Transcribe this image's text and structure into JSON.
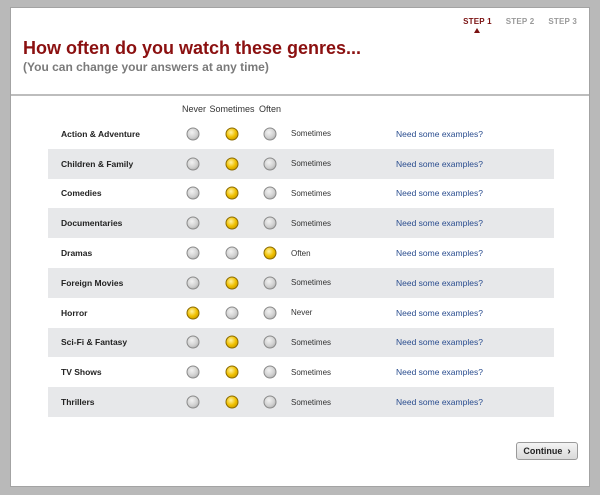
{
  "steps": [
    {
      "label": "STEP 1",
      "active": true
    },
    {
      "label": "STEP 2",
      "active": false
    },
    {
      "label": "STEP 3",
      "active": false
    }
  ],
  "header": {
    "title": "How often do you watch these genres...",
    "subtitle": "(You can change your answers at any time)"
  },
  "columns": {
    "never": "Never",
    "sometimes": "Sometimes",
    "often": "Often"
  },
  "genres": [
    {
      "name": "Action & Adventure",
      "selected": "sometimes",
      "answer": "Sometimes",
      "link": "Need some examples?"
    },
    {
      "name": "Children & Family",
      "selected": "sometimes",
      "answer": "Sometimes",
      "link": "Need some examples?"
    },
    {
      "name": "Comedies",
      "selected": "sometimes",
      "answer": "Sometimes",
      "link": "Need some examples?"
    },
    {
      "name": "Documentaries",
      "selected": "sometimes",
      "answer": "Sometimes",
      "link": "Need some examples?"
    },
    {
      "name": "Dramas",
      "selected": "often",
      "answer": "Often",
      "link": "Need some examples?"
    },
    {
      "name": "Foreign Movies",
      "selected": "sometimes",
      "answer": "Sometimes",
      "link": "Need some examples?"
    },
    {
      "name": "Horror",
      "selected": "never",
      "answer": "Never",
      "link": "Need some examples?"
    },
    {
      "name": "Sci-Fi & Fantasy",
      "selected": "sometimes",
      "answer": "Sometimes",
      "link": "Need some examples?"
    },
    {
      "name": "TV Shows",
      "selected": "sometimes",
      "answer": "Sometimes",
      "link": "Need some examples?"
    },
    {
      "name": "Thrillers",
      "selected": "sometimes",
      "answer": "Sometimes",
      "link": "Need some examples?"
    }
  ],
  "continue_button": {
    "label": "Continue",
    "icon": "chevron-right-icon"
  },
  "colors": {
    "title": "#8b1010",
    "selected_radio": "#f0c000",
    "link": "#2a4d8f",
    "alt_row": "#e7e8ea"
  }
}
